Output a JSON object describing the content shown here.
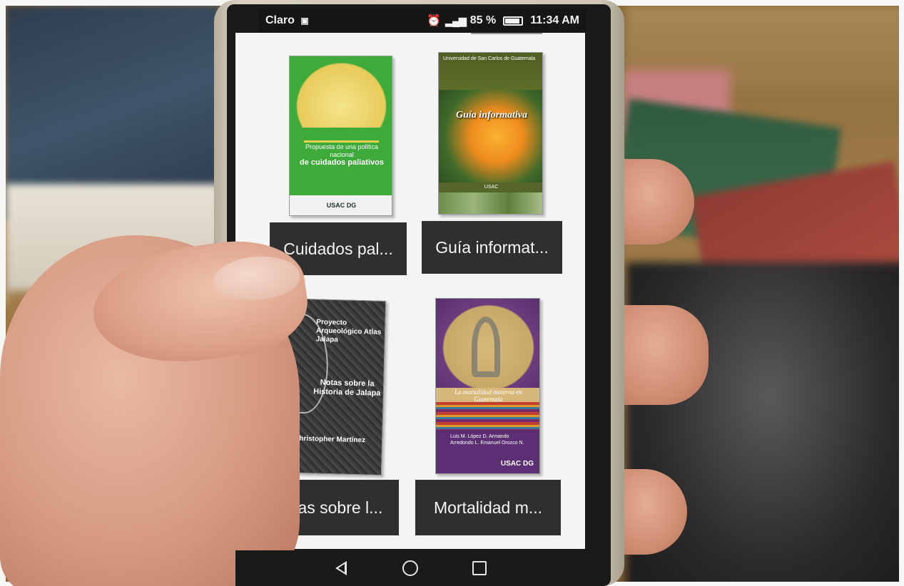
{
  "status_bar": {
    "carrier": "Claro",
    "battery_percent": "85 %",
    "time": "11:34 AM"
  },
  "books": [
    {
      "label": "Cuidados pal...",
      "cover_title_line1": "Propuesta de una política nacional",
      "cover_title_line2": "de cuidados paliativos",
      "cover_footer": "USAC  DG"
    },
    {
      "label": "Guía informat...",
      "cover_header": "Universidad de San Carlos de Guatemala",
      "cover_title": "Guía informativa",
      "cover_brand": "USAC"
    },
    {
      "label": "Notas sobre l...",
      "cover_line1": "Proyecto Arqueológico Atlas Jalapa",
      "cover_line2": "Notas sobre la Historia de Jalapa",
      "cover_author": "Christopher Martínez"
    },
    {
      "label": "Mortalidad m...",
      "cover_title": "La mortalidad materna en Guatemala",
      "cover_names": "Luis M. López D.\nArmando Arredondo L.\nEmanuel Orozco N.",
      "cover_brand": "USAC  DG"
    }
  ],
  "nav": {
    "back": "back",
    "home": "home",
    "recent": "recent apps"
  },
  "icons": {
    "alarm": "alarm-icon",
    "signal": "signal-icon",
    "battery": "battery-icon"
  }
}
